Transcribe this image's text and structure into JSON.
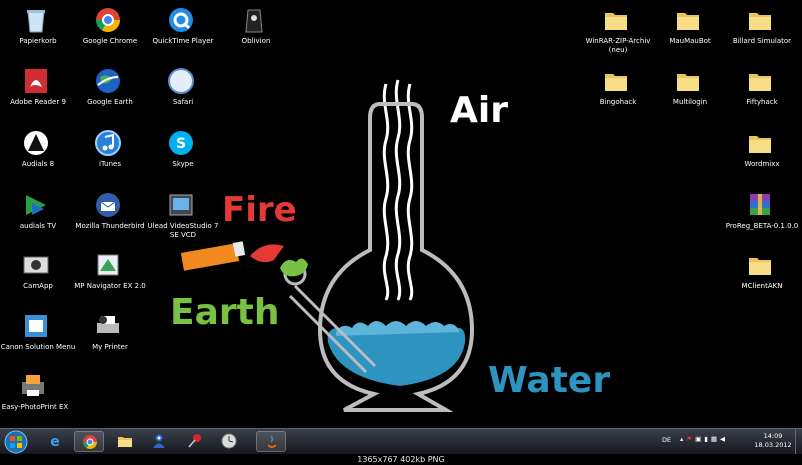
{
  "desktop_icons": [
    {
      "name": "recycle-bin",
      "label": "Papierkorb",
      "icon": "recycle-bin-icon"
    },
    {
      "name": "google-chrome",
      "label": "Google Chrome",
      "icon": "chrome-icon"
    },
    {
      "name": "quicktime-player",
      "label": "QuickTime Player",
      "icon": "quicktime-icon"
    },
    {
      "name": "oblivion",
      "label": "Oblivion",
      "icon": "oblivion-icon"
    },
    {
      "name": "adobe-reader-9",
      "label": "Adobe Reader 9",
      "icon": "adobe-reader-icon"
    },
    {
      "name": "google-earth",
      "label": "Google Earth",
      "icon": "google-earth-icon"
    },
    {
      "name": "safari",
      "label": "Safari",
      "icon": "safari-icon"
    },
    {
      "name": "audials-8",
      "label": "Audials 8",
      "icon": "audials-icon"
    },
    {
      "name": "itunes",
      "label": "iTunes",
      "icon": "itunes-icon"
    },
    {
      "name": "skype",
      "label": "Skype",
      "icon": "skype-icon"
    },
    {
      "name": "audials-tv",
      "label": "audials TV",
      "icon": "audials-tv-icon"
    },
    {
      "name": "mozilla-thunderbird",
      "label": "Mozilla Thunderbird",
      "icon": "thunderbird-icon"
    },
    {
      "name": "ulead-videostudio",
      "label": "Ulead VideoStudio 7 SE VCD",
      "icon": "videostudio-icon"
    },
    {
      "name": "camapp",
      "label": "CamApp",
      "icon": "camapp-icon"
    },
    {
      "name": "mp-navigator",
      "label": "MP Navigator EX 2.0",
      "icon": "mp-navigator-icon"
    },
    {
      "name": "canon-solution-menu",
      "label": "Canon Solution Menu",
      "icon": "canon-icon"
    },
    {
      "name": "my-printer",
      "label": "My Printer",
      "icon": "printer-icon"
    },
    {
      "name": "easy-photoprint",
      "label": "Easy-PhotoPrint EX",
      "icon": "photoprint-icon"
    },
    {
      "name": "winrar-archiv",
      "label": "WinRAR-ZIP-Archiv (neu)",
      "icon": "folder-icon"
    },
    {
      "name": "maumaubot",
      "label": "MauMauBot",
      "icon": "folder-icon"
    },
    {
      "name": "billard-simulator",
      "label": "Billard Simulator",
      "icon": "folder-icon"
    },
    {
      "name": "bingohack",
      "label": "Bingohack",
      "icon": "folder-icon"
    },
    {
      "name": "multilogin",
      "label": "Multilogin",
      "icon": "folder-icon"
    },
    {
      "name": "fiftyhack",
      "label": "Fiftyhack",
      "icon": "folder-icon"
    },
    {
      "name": "wordmixx",
      "label": "Wordmixx",
      "icon": "folder-icon"
    },
    {
      "name": "proreg-beta",
      "label": "ProReg_BETA-0.1.0.0",
      "icon": "winrar-icon"
    },
    {
      "name": "mclientakn",
      "label": "MClientAKN",
      "icon": "folder-icon"
    }
  ],
  "wallpaper": {
    "air": "Air",
    "fire": "Fire",
    "earth": "Earth",
    "water": "Water"
  },
  "taskbar": {
    "pinned": [
      "internet-explorer-icon",
      "chrome-icon",
      "explorer-folder-icon",
      "messenger-icon",
      "pushpin-icon",
      "clock-app-icon",
      "java-icon"
    ],
    "language": "DE",
    "time": "14:09",
    "date": "18.03.2012"
  },
  "caption": "1365x767  402kb  PNG"
}
